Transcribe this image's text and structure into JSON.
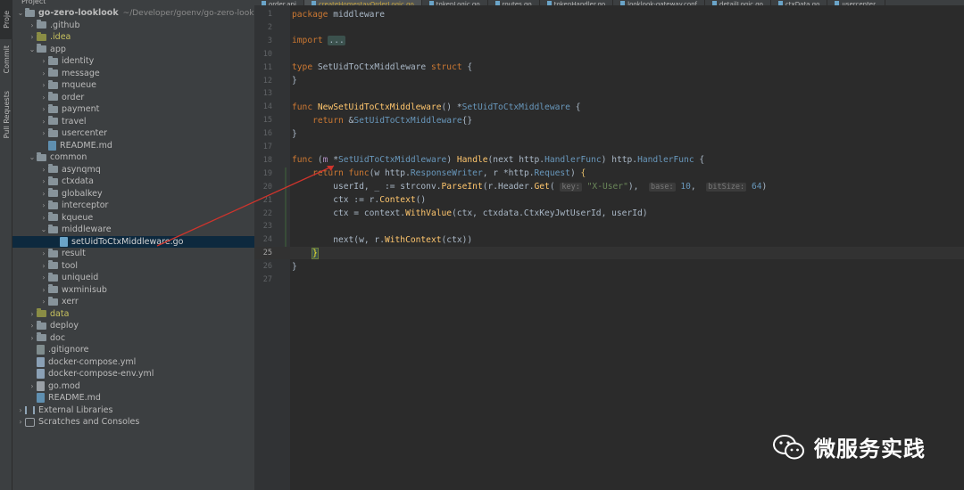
{
  "toolstrip": {
    "items": [
      {
        "label": "Proje",
        "icon": "folder-icon"
      },
      {
        "label": "Commit",
        "icon": "commit-icon"
      },
      {
        "label": "Pull Requests",
        "icon": "pull-request-icon"
      }
    ]
  },
  "project": {
    "header": "Project",
    "tree": [
      {
        "label": "go-zero-looklook",
        "path": "~/Developer/goenv/go-zero-looklook",
        "kind": "folder",
        "depth": 0,
        "expanded": true,
        "bold": true
      },
      {
        "label": ".github",
        "kind": "folder",
        "depth": 1,
        "expanded": false
      },
      {
        "label": ".idea",
        "kind": "folder-olive",
        "depth": 1,
        "expanded": false
      },
      {
        "label": "app",
        "kind": "folder",
        "depth": 1,
        "expanded": true
      },
      {
        "label": "identity",
        "kind": "folder",
        "depth": 2,
        "expanded": false
      },
      {
        "label": "message",
        "kind": "folder",
        "depth": 2,
        "expanded": false
      },
      {
        "label": "mqueue",
        "kind": "folder",
        "depth": 2,
        "expanded": false
      },
      {
        "label": "order",
        "kind": "folder",
        "depth": 2,
        "expanded": false
      },
      {
        "label": "payment",
        "kind": "folder",
        "depth": 2,
        "expanded": false
      },
      {
        "label": "travel",
        "kind": "folder",
        "depth": 2,
        "expanded": false
      },
      {
        "label": "usercenter",
        "kind": "folder",
        "depth": 2,
        "expanded": false
      },
      {
        "label": "README.md",
        "kind": "file-md",
        "depth": 2
      },
      {
        "label": "common",
        "kind": "folder",
        "depth": 1,
        "expanded": true
      },
      {
        "label": "asynqmq",
        "kind": "folder",
        "depth": 2,
        "expanded": false
      },
      {
        "label": "ctxdata",
        "kind": "folder",
        "depth": 2,
        "expanded": false
      },
      {
        "label": "globalkey",
        "kind": "folder",
        "depth": 2,
        "expanded": false
      },
      {
        "label": "interceptor",
        "kind": "folder",
        "depth": 2,
        "expanded": false
      },
      {
        "label": "kqueue",
        "kind": "folder",
        "depth": 2,
        "expanded": false
      },
      {
        "label": "middleware",
        "kind": "folder",
        "depth": 2,
        "expanded": true
      },
      {
        "label": "setUidToCtxMiddleware.go",
        "kind": "file-go",
        "depth": 3,
        "selected": true
      },
      {
        "label": "result",
        "kind": "folder",
        "depth": 2,
        "expanded": false
      },
      {
        "label": "tool",
        "kind": "folder",
        "depth": 2,
        "expanded": false
      },
      {
        "label": "uniqueid",
        "kind": "folder",
        "depth": 2,
        "expanded": false
      },
      {
        "label": "wxminisub",
        "kind": "folder",
        "depth": 2,
        "expanded": false
      },
      {
        "label": "xerr",
        "kind": "folder",
        "depth": 2,
        "expanded": false
      },
      {
        "label": "data",
        "kind": "folder-olive",
        "depth": 1,
        "expanded": false
      },
      {
        "label": "deploy",
        "kind": "folder",
        "depth": 1,
        "expanded": false
      },
      {
        "label": "doc",
        "kind": "folder",
        "depth": 1,
        "expanded": false
      },
      {
        "label": ".gitignore",
        "kind": "file-git",
        "depth": 1
      },
      {
        "label": "docker-compose.yml",
        "kind": "file-yml",
        "depth": 1
      },
      {
        "label": "docker-compose-env.yml",
        "kind": "file-yml",
        "depth": 1
      },
      {
        "label": "go.mod",
        "kind": "file-mod",
        "depth": 1,
        "expanded": false,
        "arrow": true
      },
      {
        "label": "README.md",
        "kind": "file-md",
        "depth": 1
      },
      {
        "label": "External Libraries",
        "kind": "lib",
        "depth": 0,
        "expanded": false
      },
      {
        "label": "Scratches and Consoles",
        "kind": "scratch",
        "depth": 0,
        "expanded": false
      }
    ]
  },
  "editor": {
    "tabs": [
      {
        "label": "order.api",
        "active": false
      },
      {
        "label": "createHomestayOrderLogic.go",
        "active": true
      },
      {
        "label": "tokenLogic.go",
        "active": false
      },
      {
        "label": "routes.go",
        "active": false
      },
      {
        "label": "tokenHandler.go",
        "active": false
      },
      {
        "label": "looklook-gateway.conf",
        "active": false
      },
      {
        "label": "detailLogic.go",
        "active": false
      },
      {
        "label": "ctxData.go",
        "active": false
      },
      {
        "label": "usercenter.",
        "active": false
      }
    ],
    "lines": [
      {
        "n": "1",
        "tokens": [
          [
            "kw",
            "package"
          ],
          [
            "",
            "middleware"
          ]
        ]
      },
      {
        "n": "2",
        "tokens": []
      },
      {
        "n": "3",
        "tokens": [
          [
            "kw",
            "import"
          ],
          [
            "",
            ""
          ],
          [
            "fold",
            "..."
          ]
        ]
      },
      {
        "n": "10",
        "tokens": []
      },
      {
        "n": "11",
        "tokens": [
          [
            "kw",
            "type"
          ],
          [
            "",
            " SetUidToCtxMiddleware "
          ],
          [
            "kw",
            "struct"
          ],
          [
            "",
            " {"
          ]
        ]
      },
      {
        "n": "12",
        "tokens": [
          [
            "",
            "}"
          ]
        ]
      },
      {
        "n": "13",
        "tokens": []
      },
      {
        "n": "14",
        "tokens": [
          [
            "kw",
            "func"
          ],
          [
            "",
            " "
          ],
          [
            "fn",
            "NewSetUidToCtxMiddleware"
          ],
          [
            "",
            "() *"
          ],
          [
            "ty",
            "SetUidToCtxMiddleware"
          ],
          [
            "",
            " {"
          ]
        ]
      },
      {
        "n": "15",
        "tokens": [
          [
            "",
            "    "
          ],
          [
            "kw",
            "return"
          ],
          [
            "",
            " &"
          ],
          [
            "ty",
            "SetUidToCtxMiddleware"
          ],
          [
            "",
            "{}"
          ]
        ]
      },
      {
        "n": "16",
        "tokens": [
          [
            "",
            "}"
          ]
        ]
      },
      {
        "n": "17",
        "tokens": []
      },
      {
        "n": "18",
        "tokens": [
          [
            "kw",
            "func"
          ],
          [
            "",
            " ("
          ],
          [
            "param",
            "m"
          ],
          [
            "",
            " *"
          ],
          [
            "ty",
            "SetUidToCtxMiddleware"
          ],
          [
            "",
            ") "
          ],
          [
            "fn",
            "Handle"
          ],
          [
            "",
            "(next "
          ],
          [
            "ty2",
            "http."
          ],
          [
            "ty",
            "HandlerFunc"
          ],
          [
            "",
            ") "
          ],
          [
            "ty2",
            "http."
          ],
          [
            "ty",
            "HandlerFunc"
          ],
          [
            "",
            " {"
          ]
        ]
      },
      {
        "n": "19",
        "tokens": [
          [
            "",
            "    "
          ],
          [
            "kw",
            "return"
          ],
          [
            "",
            " "
          ],
          [
            "kw",
            "func"
          ],
          [
            "",
            "(w "
          ],
          [
            "ty2",
            "http."
          ],
          [
            "ty",
            "ResponseWriter"
          ],
          [
            "",
            ", r *"
          ],
          [
            "ty2",
            "http."
          ],
          [
            "ty",
            "Request"
          ],
          [
            "",
            ") "
          ],
          [
            "brace-yel",
            "{"
          ]
        ]
      },
      {
        "n": "20",
        "tokens": [
          [
            "",
            "        userId, _ := strconv."
          ],
          [
            "fn",
            "ParseInt"
          ],
          [
            "",
            "(r.Header."
          ],
          [
            "fn",
            "Get"
          ],
          [
            "",
            "( "
          ],
          [
            "hint",
            "key:"
          ],
          [
            "str",
            " \"X-User\""
          ],
          [
            "",
            "),  "
          ],
          [
            "hint",
            "base:"
          ],
          [
            "num",
            " 10"
          ],
          [
            "",
            ",  "
          ],
          [
            "hint",
            "bitSize:"
          ],
          [
            "num",
            " 64"
          ],
          [
            "",
            ")"
          ]
        ]
      },
      {
        "n": "21",
        "tokens": [
          [
            "",
            "        ctx := r."
          ],
          [
            "fn",
            "Context"
          ],
          [
            "",
            "()"
          ]
        ]
      },
      {
        "n": "22",
        "tokens": [
          [
            "",
            "        ctx = context."
          ],
          [
            "fn",
            "WithValue"
          ],
          [
            "",
            "(ctx, ctxdata.CtxKeyJwtUserId, userId)"
          ]
        ]
      },
      {
        "n": "23",
        "tokens": []
      },
      {
        "n": "24",
        "tokens": [
          [
            "",
            "        next(w, r."
          ],
          [
            "fn",
            "WithContext"
          ],
          [
            "",
            "(ctx))"
          ]
        ]
      },
      {
        "n": "25",
        "tokens": [
          [
            "",
            "    "
          ],
          [
            "brace-hl",
            "}"
          ]
        ],
        "current": true
      },
      {
        "n": "26",
        "tokens": [
          [
            "",
            "}"
          ]
        ]
      },
      {
        "n": "27",
        "tokens": []
      }
    ]
  },
  "watermark": {
    "text": "微服务实践",
    "icon": "wechat-logo-icon"
  },
  "colors": {
    "background": "#2b2b2b",
    "panel": "#3c3f41",
    "selection": "#0d293e",
    "keyword": "#cc7832",
    "function": "#ffc66d",
    "type": "#6897bb",
    "string": "#6a8759",
    "annotation_arrow": "#d0342c"
  }
}
